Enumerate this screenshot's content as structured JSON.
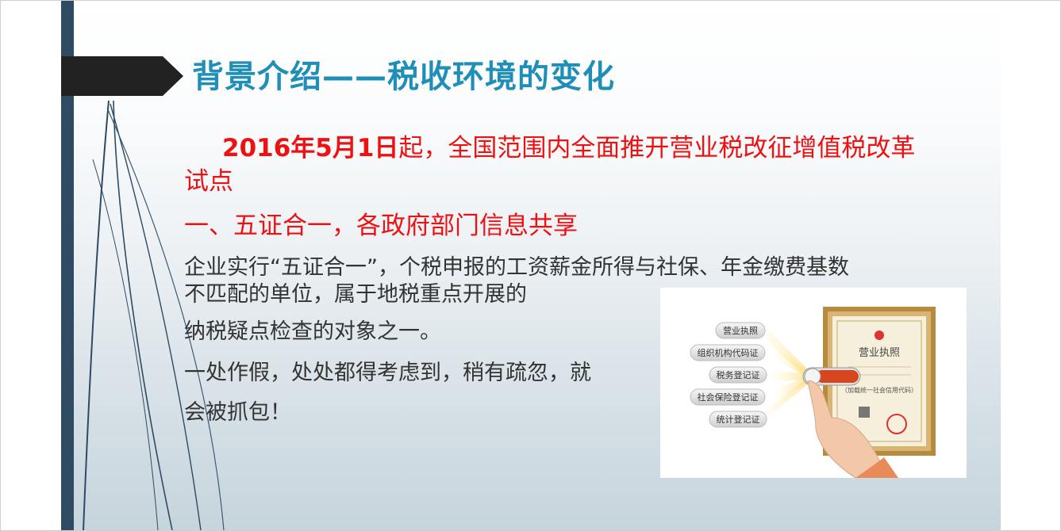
{
  "slide": {
    "title": "背景介绍——税收环境的变化",
    "red_paragraph": {
      "lead": "2016年5月1日",
      "rest": "起，全国范围内全面推开营业税改征增值税改革试点"
    },
    "red_heading": "一、五证合一，各政府部门信息共享",
    "body_lines": [
      "企业实行“五证合一”，个税申报的工资薪金所得与社保、年金缴费基数",
      "不匹配的单位，属于地税重点开展的",
      "纳税疑点检查的对象之一。",
      "一处作假，处处都得考虑到，稍有疏忽，就",
      "会被抓包！"
    ],
    "illustration": {
      "pill_labels": [
        "营业执照",
        "组织机构代码证",
        "税务登记证",
        "社会保险登记证",
        "统计登记证"
      ],
      "certificate_title": "营业执照",
      "certificate_code_text": "（加载统一社会信用代码）"
    }
  },
  "colors": {
    "title": "#1f8fb8",
    "red_text": "#ee1111",
    "body_text": "#333333",
    "sidebar": "#2f4a63",
    "frame": "#c8a25a"
  }
}
